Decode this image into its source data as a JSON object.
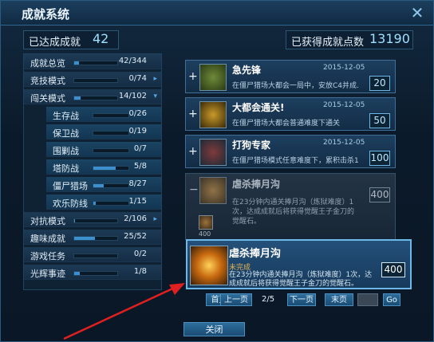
{
  "window": {
    "title": "成就系统",
    "close_glyph": "✕"
  },
  "stats": {
    "achieved_label": "已达成成就",
    "achieved_value": "42",
    "points_label": "已获得成就点数",
    "points_value": "13190"
  },
  "categories": [
    {
      "name": "成就总览",
      "count": "42/344",
      "progress": 0.12,
      "type": "cat",
      "arrow": ""
    },
    {
      "name": "竞技模式",
      "count": "0/74",
      "progress": 0.0,
      "type": "cat",
      "arrow": "▸"
    },
    {
      "name": "闯关模式",
      "count": "14/102",
      "progress": 0.14,
      "type": "cat",
      "arrow": "▾"
    },
    {
      "name": "生存战",
      "count": "0/26",
      "progress": 0.0,
      "type": "sub",
      "arrow": ""
    },
    {
      "name": "保卫战",
      "count": "0/19",
      "progress": 0.0,
      "type": "sub",
      "arrow": ""
    },
    {
      "name": "围剿战",
      "count": "0/7",
      "progress": 0.0,
      "type": "sub",
      "arrow": ""
    },
    {
      "name": "塔防战",
      "count": "5/8",
      "progress": 0.63,
      "type": "sub",
      "arrow": ""
    },
    {
      "name": "僵尸猎场",
      "count": "8/27",
      "progress": 0.3,
      "type": "sub",
      "arrow": ""
    },
    {
      "name": "欢乐防线",
      "count": "1/15",
      "progress": 0.07,
      "type": "sub",
      "arrow": ""
    },
    {
      "name": "对抗模式",
      "count": "2/106",
      "progress": 0.02,
      "type": "cat",
      "arrow": "▸"
    },
    {
      "name": "趣味成就",
      "count": "25/52",
      "progress": 0.48,
      "type": "cat",
      "arrow": ""
    },
    {
      "name": "游戏任务",
      "count": "0/2",
      "progress": 0.0,
      "type": "cat",
      "arrow": ""
    },
    {
      "name": "光辉事迹",
      "count": "1/8",
      "progress": 0.13,
      "type": "cat",
      "arrow": ""
    }
  ],
  "achievements": [
    {
      "title": "急先锋",
      "date": "2015-12-05",
      "desc": "在僵尸猎场大都会一局中，安放C4并成...",
      "points": "20",
      "toggle": "+"
    },
    {
      "title": "大都会通关!",
      "date": "2015-12-05",
      "desc": "在僵尸猎场大都会普通难度下通关",
      "points": "50",
      "toggle": "+"
    },
    {
      "title": "打狗专家",
      "date": "2015-12-05",
      "desc": "在僵尸猎场模式任意难度下，累积击杀1...",
      "points": "100",
      "toggle": "+"
    }
  ],
  "expanded": {
    "title": "虐杀捧月沟",
    "toggle": "−",
    "desc": "在23分钟内通关捧月沟（炼狱难度）1次，达成成就后将获得觉醒王子金刀的觉醒石。",
    "points": "400",
    "progress_label": "400"
  },
  "tooltip": {
    "title": "虐杀捧月沟",
    "status": "未完成",
    "desc": "在23分钟内通关捧月沟（炼狱难度）1次，达成成就后将获得觉醒王子金刀的觉醒石。",
    "points": "400"
  },
  "pager": {
    "first": "首页",
    "prev": "上一页",
    "page_info": "2/5",
    "next": "下一页",
    "last": "末页",
    "go": "Go"
  },
  "footer": {
    "close_label": "关闭"
  },
  "colors": {
    "accent": "#3d90d0",
    "tooltip_border": "#6cb8e8",
    "status": "#e0b255"
  }
}
